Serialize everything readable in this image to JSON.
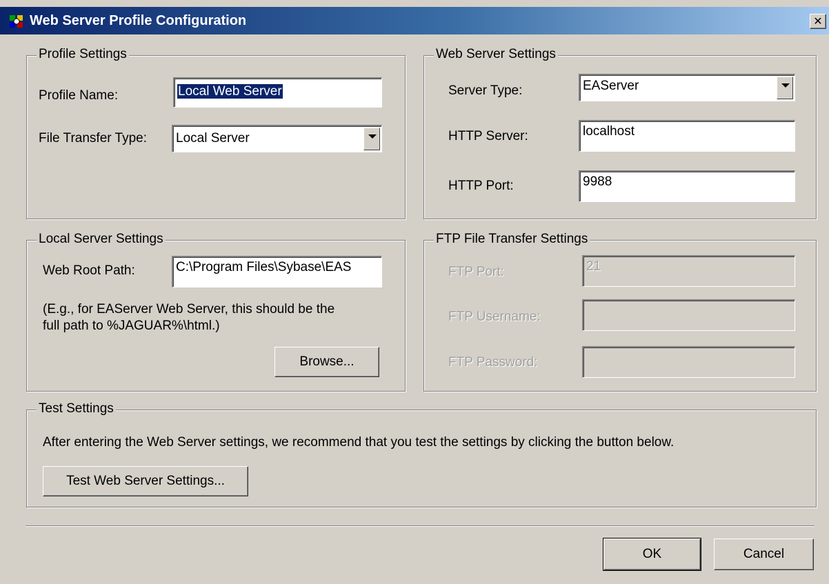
{
  "window": {
    "title": "Web Server Profile Configuration",
    "close_glyph": "✕"
  },
  "profile_settings": {
    "label": "Profile Settings",
    "profile_name_label": "Profile Name:",
    "profile_name_value": "Local Web Server",
    "file_transfer_label": "File Transfer Type:",
    "file_transfer_value": "Local Server"
  },
  "web_server_settings": {
    "label": "Web Server Settings",
    "server_type_label": "Server Type:",
    "server_type_value": "EAServer",
    "http_server_label": "HTTP Server:",
    "http_server_value": "localhost",
    "http_port_label": "HTTP Port:",
    "http_port_value": "9988"
  },
  "local_server_settings": {
    "label": "Local Server Settings",
    "web_root_label": "Web Root Path:",
    "web_root_value": "C:\\Program Files\\Sybase\\EAS",
    "hint_line1": "(E.g., for EAServer Web Server, this should be the",
    "hint_line2": "full path to %JAGUAR%\\html.)",
    "browse_label": "Browse..."
  },
  "ftp_settings": {
    "label": "FTP File Transfer Settings",
    "port_label": "FTP Port:",
    "port_value": "21",
    "username_label": "FTP Username:",
    "username_value": "",
    "password_label": "FTP Password:",
    "password_value": ""
  },
  "test_settings": {
    "label": "Test Settings",
    "description": "After entering the Web Server settings, we recommend that you test the settings by clicking the button below.",
    "test_button_label": "Test Web Server Settings..."
  },
  "buttons": {
    "ok_label": "OK",
    "cancel_label": "Cancel"
  },
  "colors": {
    "titlebar_start": "#0a246a",
    "titlebar_end": "#a6caf0",
    "selection": "#0a246a",
    "face": "#d4d0c8"
  },
  "icons": {
    "app": "web-server-profile-icon",
    "close": "close-icon",
    "dropdown": "chevron-down-icon"
  }
}
